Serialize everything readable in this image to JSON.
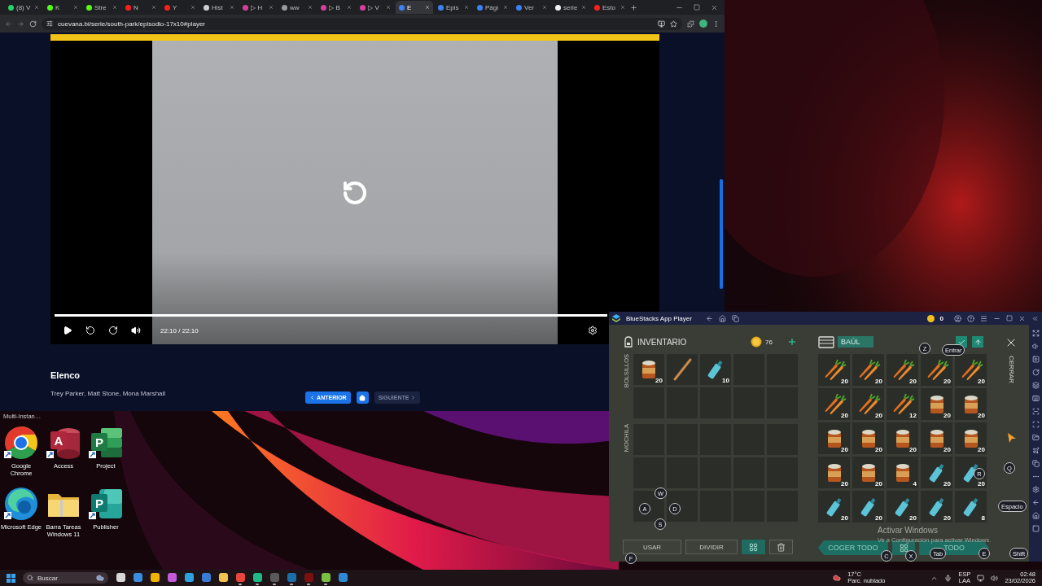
{
  "browser": {
    "tabs": [
      {
        "label": "(8) V",
        "color": "#25d366",
        "selected": false
      },
      {
        "label": "K",
        "color": "#53fc18",
        "selected": false
      },
      {
        "label": "Stre",
        "color": "#53fc18",
        "selected": false
      },
      {
        "label": "N",
        "color": "#ff1e1e",
        "selected": false
      },
      {
        "label": "Y",
        "color": "#ff1e1e",
        "selected": false
      },
      {
        "label": "Hist",
        "color": "#cfcfcf",
        "selected": false
      },
      {
        "label": "▷ H",
        "color": "#d6409a",
        "selected": false
      },
      {
        "label": "ww",
        "color": "#9a9a9a",
        "selected": false
      },
      {
        "label": "▷ B",
        "color": "#d6409a",
        "selected": false
      },
      {
        "label": "▷ V",
        "color": "#d6409a",
        "selected": false
      },
      {
        "label": "E",
        "color": "#3b82f6",
        "selected": true
      },
      {
        "label": "Epis",
        "color": "#3b82f6",
        "selected": false
      },
      {
        "label": "Pági",
        "color": "#3b82f6",
        "selected": false
      },
      {
        "label": "Ver",
        "color": "#3b82f6",
        "selected": false
      },
      {
        "label": "serie",
        "color": "#f1f1f1",
        "selected": false
      },
      {
        "label": "Esto",
        "color": "#ff1e1e",
        "selected": false
      }
    ],
    "address": "cuevana.bi/serie/south-park/episodio-17x10#player",
    "player": {
      "time": "22:10 / 22:10",
      "progress": {
        "level": 1
      }
    },
    "cast_heading": "Elenco",
    "cast": "Trey Parker, Matt Stone, Mona Marshall",
    "navigation": [
      {
        "kind": "prev",
        "label": "ANTERIOR",
        "disabled": false
      },
      {
        "kind": "home",
        "disabled": false
      },
      {
        "kind": "next",
        "label": "SIGUIENTE",
        "disabled": true
      }
    ]
  },
  "desktop": {
    "label": "Multi-Instan…",
    "icons": [
      {
        "kind": "chrome",
        "label": "Google Chrome"
      },
      {
        "kind": "access",
        "glyph": "A",
        "label": "Access"
      },
      {
        "kind": "project",
        "glyph": "P",
        "label": "Project"
      },
      {
        "kind": "edge",
        "label": "Microsoft Edge"
      },
      {
        "kind": "folder",
        "label": "Barra Tareas Windows 11"
      },
      {
        "kind": "publisher",
        "glyph": "P",
        "label": "Publisher"
      }
    ]
  },
  "bluestacks": {
    "title": "BlueStacks App Player",
    "coins": "0",
    "inventory": {
      "title": "INVENTARIO",
      "coins": "76",
      "sections": [
        {
          "label": "BOLSILLOS",
          "slots": [
            {
              "kind": "can",
              "count": "20"
            },
            {
              "kind": "bat"
            },
            {
              "kind": "bottle",
              "count": "10"
            },
            {
              "kind": "empty"
            },
            {
              "kind": "empty"
            },
            {
              "kind": "empty"
            },
            {
              "kind": "empty"
            },
            {
              "kind": "empty"
            },
            {
              "kind": "empty"
            },
            {
              "kind": "empty"
            }
          ]
        },
        {
          "label": "MOCHILA",
          "slots": [
            {
              "kind": "empty"
            },
            {
              "kind": "empty"
            },
            {
              "kind": "empty"
            },
            {
              "kind": "empty"
            },
            {
              "kind": "empty"
            },
            {
              "kind": "empty"
            },
            {
              "kind": "empty"
            },
            {
              "kind": "empty"
            },
            {
              "kind": "empty"
            },
            {
              "kind": "empty"
            },
            {
              "kind": "empty"
            },
            {
              "kind": "empty"
            },
            {
              "kind": "empty"
            },
            {
              "kind": "empty"
            },
            {
              "kind": "empty"
            }
          ]
        }
      ],
      "buttons": [
        {
          "kind": "text",
          "label": "USAR"
        },
        {
          "kind": "text",
          "label": "DIVIDIR"
        },
        {
          "kind": "sort"
        },
        {
          "kind": "trash"
        }
      ]
    },
    "chest": {
      "title": "BAÚL",
      "slots": [
        {
          "kind": "carrot",
          "count": "20"
        },
        {
          "kind": "carrot",
          "count": "20"
        },
        {
          "kind": "carrot",
          "count": "20"
        },
        {
          "kind": "carrot",
          "count": "20"
        },
        {
          "kind": "carrot",
          "count": "20"
        },
        {
          "kind": "carrot",
          "count": "20"
        },
        {
          "kind": "carrot",
          "count": "20"
        },
        {
          "kind": "carrot",
          "count": "12"
        },
        {
          "kind": "can",
          "count": "20"
        },
        {
          "kind": "can",
          "count": "20"
        },
        {
          "kind": "can",
          "count": "20"
        },
        {
          "kind": "can",
          "count": "20"
        },
        {
          "kind": "can",
          "count": "20"
        },
        {
          "kind": "can",
          "count": "20"
        },
        {
          "kind": "can",
          "count": "20"
        },
        {
          "kind": "can",
          "count": "20"
        },
        {
          "kind": "can",
          "count": "20"
        },
        {
          "kind": "can",
          "count": "4"
        },
        {
          "kind": "bottle",
          "count": "20"
        },
        {
          "kind": "bottle",
          "count": "20"
        },
        {
          "kind": "bottle",
          "count": "20"
        },
        {
          "kind": "bottle",
          "count": "20"
        },
        {
          "kind": "bottle",
          "count": "20"
        },
        {
          "kind": "bottle",
          "count": "20"
        },
        {
          "kind": "bottle",
          "count": "8"
        }
      ],
      "buttons": [
        {
          "kind": "take",
          "label": "COGER TODO"
        },
        {
          "kind": "sort"
        },
        {
          "kind": "put",
          "label": "TODO"
        }
      ]
    },
    "close_label": "CERRAR",
    "key_hints": [
      {
        "label": "Z"
      },
      {
        "label": "Entrar"
      },
      {
        "label": "Q"
      },
      {
        "label": "Espacio"
      },
      {
        "label": "Shift"
      },
      {
        "label": "W"
      },
      {
        "label": "A"
      },
      {
        "label": "D"
      },
      {
        "label": "S"
      },
      {
        "label": "F"
      },
      {
        "label": "C"
      },
      {
        "label": "X"
      },
      {
        "label": "Tab"
      },
      {
        "label": "E"
      },
      {
        "label": "R"
      }
    ],
    "watermark": {
      "title": "Activar Windows",
      "text": "Ve a Configuración para activar Windows."
    }
  },
  "taskbar": {
    "search": "Buscar",
    "apps": [
      {
        "color": "#d8d8d8",
        "running": false
      },
      {
        "color": "#3b8de0",
        "running": false
      },
      {
        "color": "#f0b400",
        "running": false
      },
      {
        "color": "#c45ad8",
        "running": false
      },
      {
        "color": "#2fa0e0",
        "running": false
      },
      {
        "color": "#3a7bd5",
        "running": false
      },
      {
        "color": "#f2c14e",
        "running": false
      },
      {
        "color": "#e8453c",
        "running": true
      },
      {
        "color": "#1db987",
        "running": true
      },
      {
        "color": "#5a5a5a",
        "running": true
      },
      {
        "color": "#1b6fa8",
        "running": true
      },
      {
        "color": "#7a1010",
        "running": true
      },
      {
        "color": "#7ac143",
        "running": true
      },
      {
        "color": "#2d88d8",
        "running": false
      }
    ],
    "weather": {
      "temp": "17°C",
      "text": "Parc. nublado"
    },
    "language": [
      "ESP",
      "LAA"
    ],
    "time": "02:48",
    "date": "23/02/2026"
  }
}
